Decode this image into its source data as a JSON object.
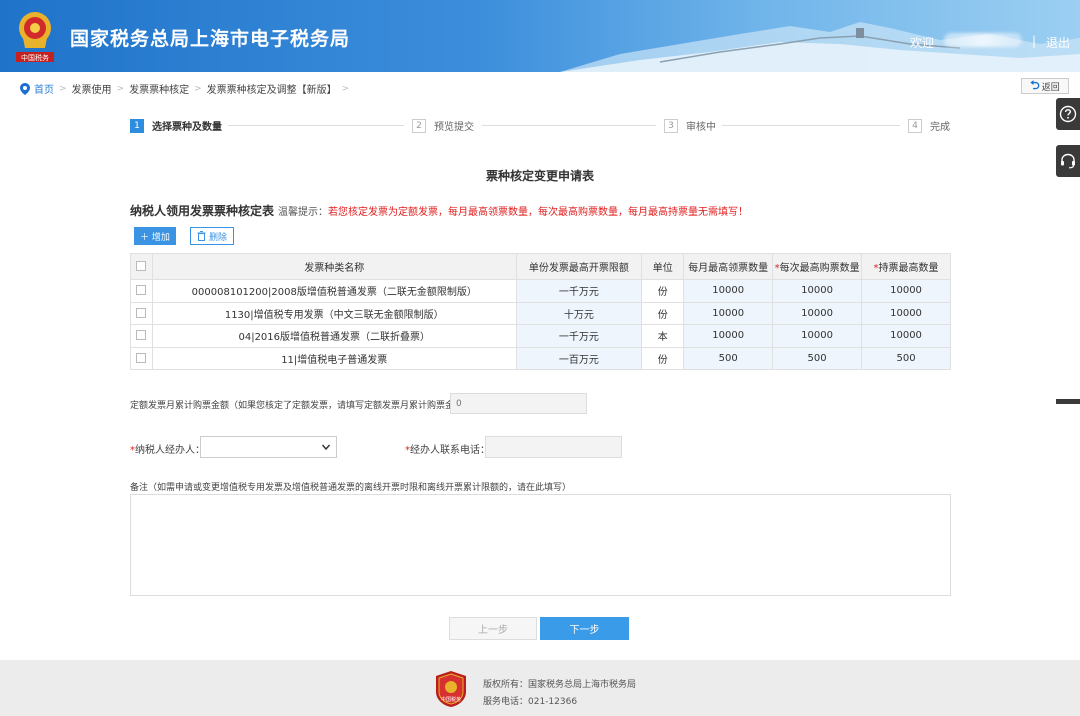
{
  "header": {
    "title": "国家税务总局上海市电子税务局",
    "welcome": "欢迎",
    "separator": "|",
    "logout": "退出",
    "emblem_text": "中国税务"
  },
  "breadcrumb": {
    "items": [
      "首页",
      "发票使用",
      "发票票种核定",
      "发票票种核定及调整【新版】"
    ],
    "back": "返回"
  },
  "steps": [
    {
      "num": "1",
      "label": "选择票种及数量",
      "active": true
    },
    {
      "num": "2",
      "label": "预览提交",
      "active": false
    },
    {
      "num": "3",
      "label": "审核中",
      "active": false
    },
    {
      "num": "4",
      "label": "完成",
      "active": false
    }
  ],
  "form": {
    "title": "票种核定变更申请表",
    "section_title": "纳税人领用发票票种核定表",
    "tip_label": "温馨提示：",
    "tip_text": "若您核定发票为定额发票，每月最高领票数量，每次最高购票数量，每月最高持票量无需填写！",
    "add_button": "＋ 增加",
    "delete_button": "删除"
  },
  "table": {
    "headers": [
      "发票种类名称",
      "单份发票最高开票限额",
      "单位",
      "每月最高领票数量",
      "每次最高购票数量",
      "持票最高数量"
    ],
    "required_mark": "*",
    "rows": [
      [
        "000008101200|2008版增值税普通发票（二联无金额限制版）",
        "一千万元",
        "份",
        "10000",
        "10000",
        "10000"
      ],
      [
        "1130|增值税专用发票（中文三联无金额限制版）",
        "十万元",
        "份",
        "10000",
        "10000",
        "10000"
      ],
      [
        "04|2016版增值税普通发票（二联折叠票）",
        "一千万元",
        "本",
        "10000",
        "10000",
        "10000"
      ],
      [
        "11|增值税电子普通发票",
        "一百万元",
        "份",
        "500",
        "500",
        "500"
      ]
    ]
  },
  "fields": {
    "amount_label": "定额发票月累计购票金额（如果您核定了定额发票，请填写定额发票月累计购票金额）：",
    "amount_value": "0",
    "agent_label": "纳税人经办人：",
    "phone_label": "经办人联系电话：",
    "remark_label": "备注（如需申请或变更增值税专用发票及增值税普通发票的离线开票时限和离线开票累计限额的，请在此填写）"
  },
  "buttons": {
    "prev": "上一步",
    "next": "下一步"
  },
  "footer": {
    "copyright": "版权所有：国家税务总局上海市税务局",
    "service": "服务电话：021-12366",
    "logo_text": "中国税务"
  },
  "colors": {
    "primary": "#3a93e3",
    "required": "#e02020",
    "header_start": "#1f73c9",
    "header_end": "#9ccff2"
  },
  "icons": {
    "location": "location-pin-icon",
    "back": "return-arrow-icon",
    "help": "question-icon",
    "support": "headset-icon",
    "delete": "trash-icon",
    "dropdown": "chevron-down-icon"
  }
}
